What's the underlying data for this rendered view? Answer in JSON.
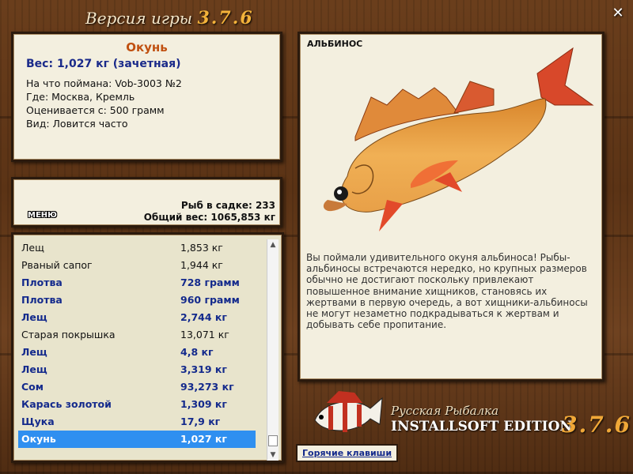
{
  "window": {
    "title": "Версия игры",
    "version": "3.7.6"
  },
  "fish_card": {
    "name": "Окунь",
    "weight": "Вес: 1,027 кг (зачетная)",
    "caught_on": "На что поймана: Vob-3003 №2",
    "location": "Где: Москва, Кремль",
    "rated_from": "Оценивается с: 500 грамм",
    "kind": "Вид: Ловится часто"
  },
  "stats": {
    "menu_label": "МЕНЮ",
    "fish_count": "Рыб в садке: 233",
    "total_weight": "Общий вес: 1065,853 кг"
  },
  "catch_list": {
    "rows": [
      {
        "name": "Лещ",
        "weight": "1,853 кг"
      },
      {
        "name": "Рваный сапог",
        "weight": "1,944 кг"
      },
      {
        "name": "Плотва",
        "weight": "728 грамм"
      },
      {
        "name": "Плотва",
        "weight": "960 грамм"
      },
      {
        "name": "Лещ",
        "weight": "2,744 кг"
      },
      {
        "name": "Старая покрышка",
        "weight": "13,071 кг"
      },
      {
        "name": "Лещ",
        "weight": "4,8 кг"
      },
      {
        "name": "Лещ",
        "weight": "3,319 кг"
      },
      {
        "name": "Сом",
        "weight": "93,273 кг"
      },
      {
        "name": "Карась золотой",
        "weight": "1,309 кг"
      },
      {
        "name": "Щука",
        "weight": "17,9 кг"
      },
      {
        "name": "Окунь",
        "weight": "1,027 кг"
      }
    ]
  },
  "image_panel": {
    "label": "АЛЬБИНОС",
    "description": "Вы поймали удивительного окуня альбиноса! Рыбы-альбиносы встречаются нередко, но крупных размеров обычно не достигают поскольку привлекают повышенное внимание хищников, становясь их жертвами в первую очередь, а вот хищники-альбиносы не могут незаметно подкрадываться к жертвам и добывать себе пропитание."
  },
  "hotkeys_label": "Горячие клавиши",
  "logo": {
    "line1": "Русская Рыбалка",
    "line2": "INSTALLSOFT EDITION",
    "version": "3.7.6"
  },
  "colors": {
    "accent_blue": "#142a8c",
    "fish_name_orange": "#c05010",
    "selection": "#2f8ff0",
    "version_gold": "#f3b23a"
  }
}
